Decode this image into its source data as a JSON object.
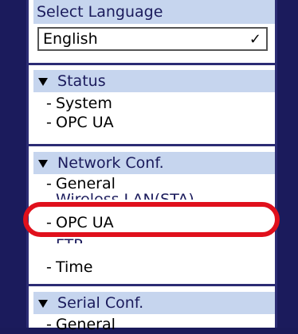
{
  "sidebar": {
    "language": {
      "header": "Select Language",
      "selected": "English"
    },
    "groups": [
      {
        "title": "Status",
        "items": [
          "System",
          "OPC UA"
        ]
      },
      {
        "title": "Network Conf.",
        "items": [
          "General",
          "Wireless LAN(STA)",
          "OPC UA",
          "FTP",
          "Time"
        ]
      },
      {
        "title": "Serial Conf.",
        "items": [
          "General"
        ]
      }
    ]
  },
  "colors": {
    "frame": "#1b1b5c",
    "header_bg": "#c6d5ee",
    "highlight": "#e0101c"
  }
}
